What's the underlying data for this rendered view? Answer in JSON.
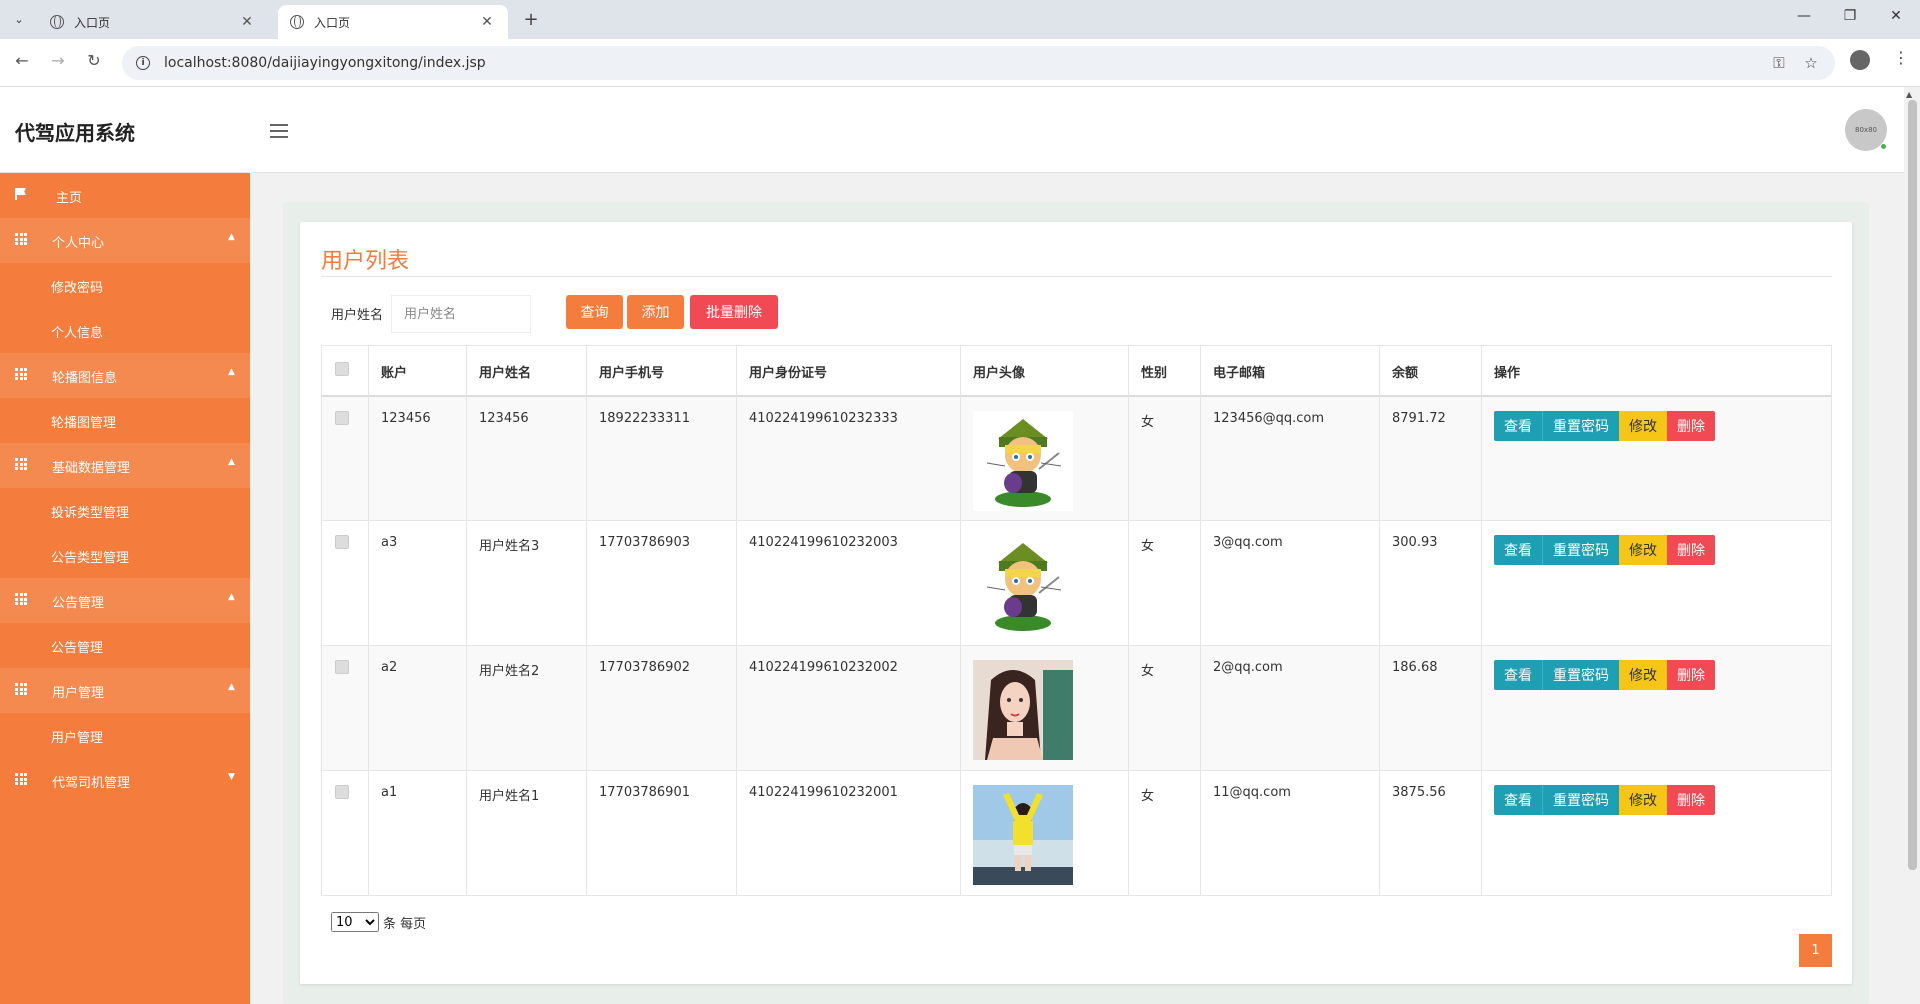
{
  "browser": {
    "tabs": [
      {
        "title": "入口页",
        "active": false
      },
      {
        "title": "入口页",
        "active": true
      }
    ],
    "url": "localhost:8080/daijiayingyongxitong/index.jsp"
  },
  "header": {
    "app_title": "代驾应用系统",
    "avatar_text": "80x80"
  },
  "sidebar": {
    "home": "主页",
    "groups": [
      {
        "label": "个人中心",
        "items": [
          "修改密码",
          "个人信息"
        ]
      },
      {
        "label": "轮播图信息",
        "items": [
          "轮播图管理"
        ]
      },
      {
        "label": "基础数据管理",
        "items": [
          "投诉类型管理",
          "公告类型管理"
        ]
      },
      {
        "label": "公告管理",
        "items": [
          "公告管理"
        ]
      },
      {
        "label": "用户管理",
        "items": [
          "用户管理"
        ]
      },
      {
        "label": "代驾司机管理",
        "items": []
      }
    ]
  },
  "main": {
    "title": "用户列表",
    "search": {
      "label": "用户姓名",
      "placeholder": "用户姓名",
      "value": ""
    },
    "buttons": {
      "query": "查询",
      "add": "添加",
      "batch_delete": "批量删除"
    },
    "table": {
      "columns": [
        "账户",
        "用户姓名",
        "用户手机号",
        "用户身份证号",
        "用户头像",
        "性别",
        "电子邮箱",
        "余额",
        "操作"
      ],
      "rows": [
        {
          "account": "123456",
          "name": "123456",
          "phone": "18922233311",
          "id_card": "410224199610232333",
          "avatar": "cartoon-ninja-avatar",
          "gender": "女",
          "email": "123456@qq.com",
          "balance": "8791.72"
        },
        {
          "account": "a3",
          "name": "用户姓名3",
          "phone": "17703786903",
          "id_card": "410224199610232003",
          "avatar": "cartoon-ninja-avatar",
          "gender": "女",
          "email": "3@qq.com",
          "balance": "300.93"
        },
        {
          "account": "a2",
          "name": "用户姓名2",
          "phone": "17703786902",
          "id_card": "410224199610232002",
          "avatar": "woman-portrait-avatar",
          "gender": "女",
          "email": "2@qq.com",
          "balance": "186.68"
        },
        {
          "account": "a1",
          "name": "用户姓名1",
          "phone": "17703786901",
          "id_card": "410224199610232001",
          "avatar": "beach-girl-avatar",
          "gender": "女",
          "email": "11@qq.com",
          "balance": "3875.56"
        }
      ],
      "actions": {
        "view": "查看",
        "reset": "重置密码",
        "edit": "修改",
        "delete": "删除"
      }
    },
    "pagination": {
      "page_size": "10",
      "page_size_options": [
        "10"
      ],
      "per_page_label": "条 每页",
      "current_page": "1"
    }
  },
  "colors": {
    "accent": "#f47c3c",
    "danger": "#f14a55",
    "info": "#1e9fb4",
    "warning": "#f5c518"
  }
}
